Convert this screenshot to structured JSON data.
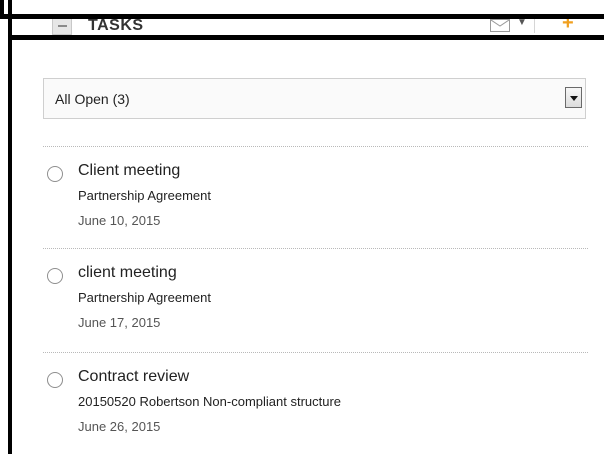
{
  "panel": {
    "title": "TASKS"
  },
  "icons": {
    "collapse": "minus-square-icon",
    "email": "envelope-icon",
    "menu": "caret-down-icon",
    "add": "plus-icon",
    "radio": "radio-circle-icon",
    "dropdown": "select-arrow-icon"
  },
  "colors": {
    "accent_add": "#f0a020",
    "text_primary": "#222222",
    "text_date": "#555555"
  },
  "filter": {
    "selected": "All Open (3)"
  },
  "tasks": [
    {
      "title": "Client meeting",
      "matter": "Partnership Agreement",
      "date": "June 10, 2015"
    },
    {
      "title": "client meeting",
      "matter": "Partnership Agreement",
      "date": "June 17, 2015"
    },
    {
      "title": "Contract review",
      "matter": "20150520 Robertson Non-compliant structure",
      "date": "June 26, 2015"
    }
  ]
}
